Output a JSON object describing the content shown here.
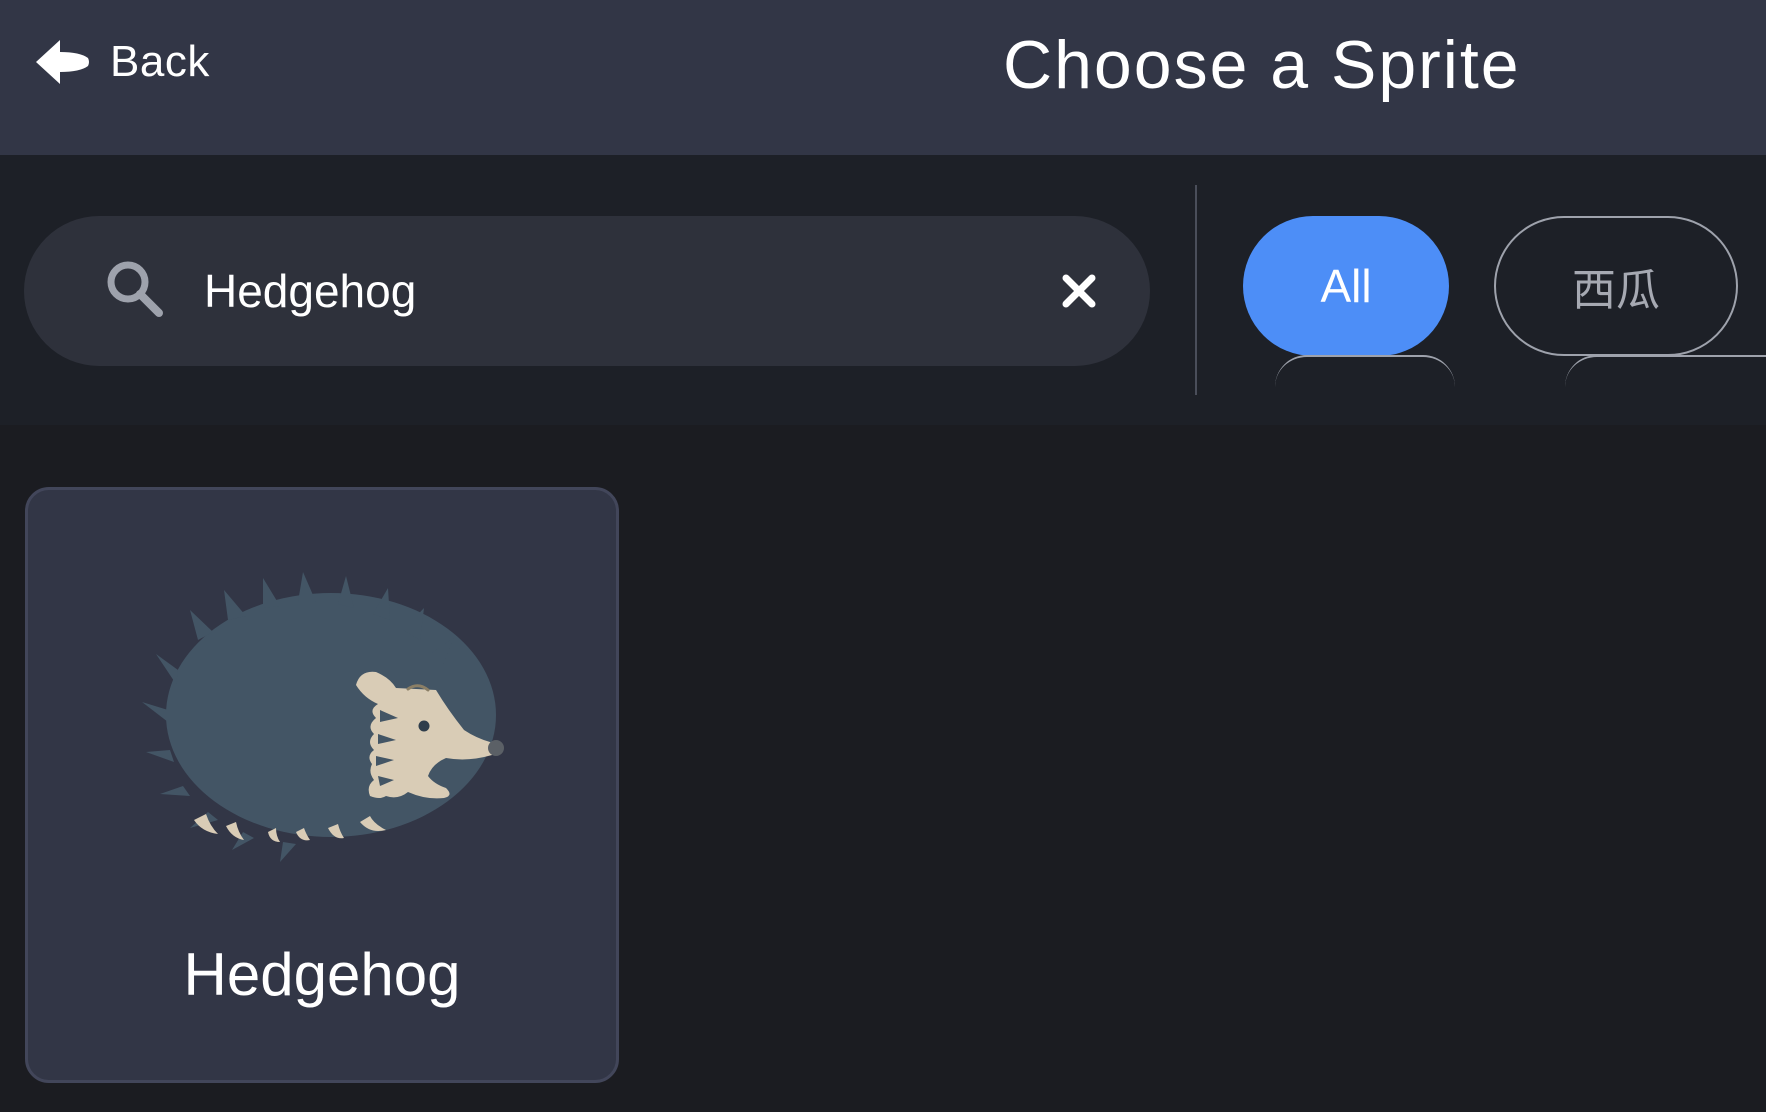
{
  "header": {
    "back_label": "Back",
    "title": "Choose a Sprite"
  },
  "search": {
    "value": "Hedgehog",
    "icon": "search-icon",
    "clear_icon": "close-icon"
  },
  "filters": [
    {
      "label": "All",
      "selected": true
    },
    {
      "label": "西瓜",
      "selected": false
    }
  ],
  "sprites": [
    {
      "name": "Hedgehog",
      "icon": "hedgehog-icon"
    }
  ],
  "colors": {
    "header_bg": "#323646",
    "page_bg": "#1b1c21",
    "accent": "#4d8ef7",
    "card_bg": "#323646",
    "hedgehog_spines": "#435565",
    "hedgehog_body": "#d9ccb6"
  }
}
